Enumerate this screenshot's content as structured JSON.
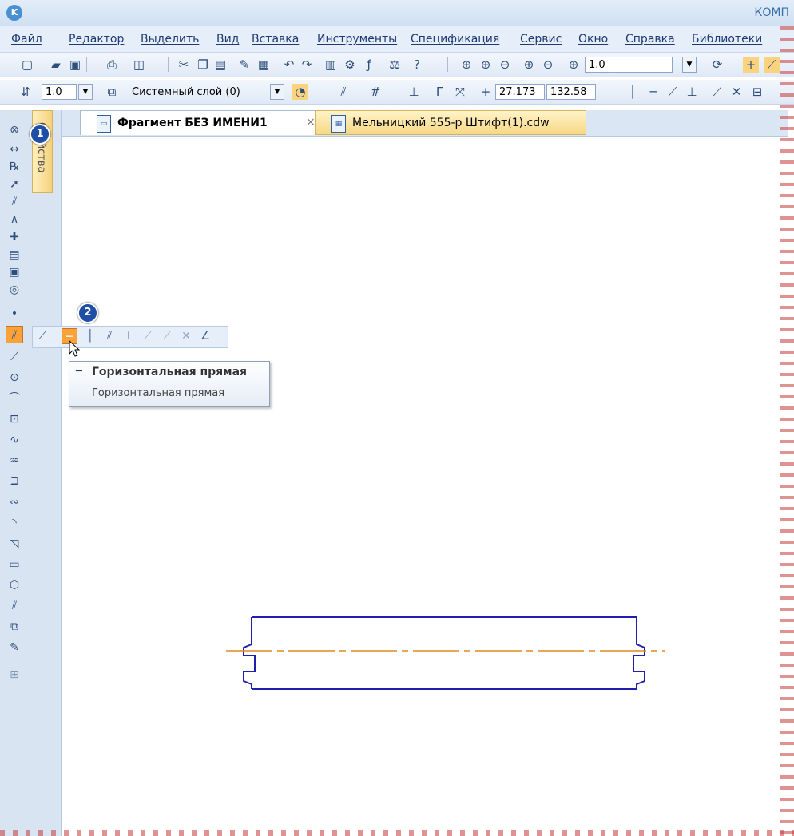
{
  "window": {
    "title": "КОМП",
    "logo": "K"
  },
  "menu": [
    "Файл",
    "Редактор",
    "Выделить",
    "Вид",
    "Вставка",
    "Инструменты",
    "Спецификация",
    "Сервис",
    "Окно",
    "Справка",
    "Библиотеки"
  ],
  "toolbar1": {
    "zoom_value": "1.0"
  },
  "toolbar2": {
    "line_scale": "1.0",
    "layer": "Системный слой (0)",
    "coord_x": "27.173",
    "coord_y": "132.58"
  },
  "tabs": [
    {
      "label": "Фрагмент БЕЗ ИМЕНИ1",
      "close": "×"
    },
    {
      "label": "Мельницкий 555-р Штифт(1).cdw"
    }
  ],
  "props_panel": {
    "label": "Свойства"
  },
  "badges": [
    "1",
    "2"
  ],
  "tooltip": {
    "title": "Горизонтальная прямая",
    "description": "Горизонтальная прямая"
  },
  "colors": {
    "drawing": "#1f1fb0",
    "centerline": "#e08a1e",
    "selected_tool": "#f9a23a"
  }
}
